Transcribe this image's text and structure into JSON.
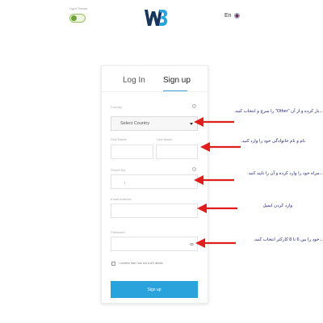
{
  "header": {
    "theme_toggle_label": "Light Theme",
    "language": "En"
  },
  "tabs": {
    "login": "Log In",
    "signup": "Sign up"
  },
  "form": {
    "country_label": "Country",
    "country_value": "Select Country",
    "first_name_label": "First Name",
    "last_name_label": "Last Name",
    "phone_label": "Phone No.",
    "email_label": "Email Address",
    "password_label": "Password",
    "confirm_text": "I confirm that I am not a US citizen",
    "signup_button": "Sign up"
  },
  "annotations": [
    "...باز کرده و از آن \"Other\" را سرچ و انتخاب کنید.",
    "نام و نام خانوادگی خود را وارد کنید.",
    "...مراه خود را وارد کرده و آن را تایید کنید.",
    "وارد کردن ایمیل",
    "...خود را بین 6 تا 8 کارکتر انتخاب کنید."
  ],
  "colors": {
    "accent": "#2aa3dc",
    "arrow": "#e01e1e",
    "annotation_text": "#1f1f7a"
  }
}
